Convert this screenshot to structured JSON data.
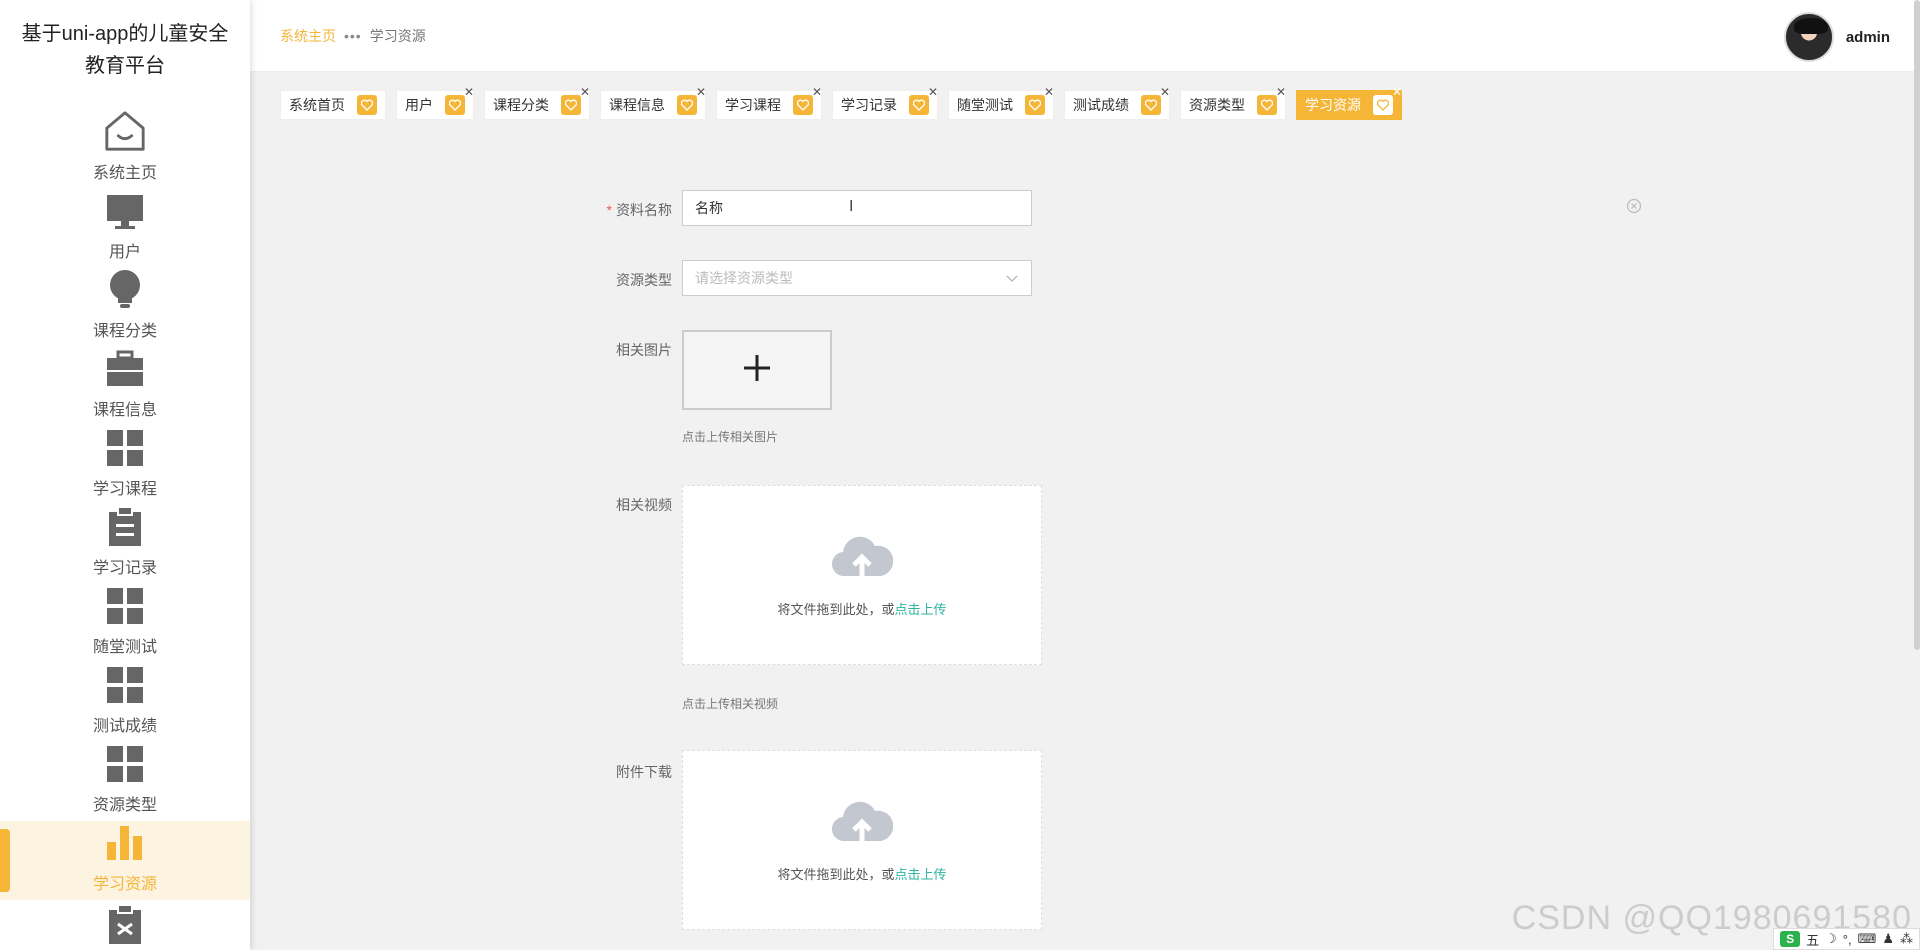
{
  "brand": {
    "title_line1": "基于uni-app的儿童安全",
    "title_line2": "教育平台"
  },
  "header": {
    "breadcrumb_home": "系统主页",
    "breadcrumb_sep": "•••",
    "breadcrumb_current": "学习资源",
    "username": "admin"
  },
  "sidebar": {
    "items": [
      {
        "label": "系统主页",
        "icon": "home-icon"
      },
      {
        "label": "用户",
        "icon": "monitor-icon"
      },
      {
        "label": "课程分类",
        "icon": "lightbulb-icon"
      },
      {
        "label": "课程信息",
        "icon": "briefcase-icon"
      },
      {
        "label": "学习课程",
        "icon": "grid-icon"
      },
      {
        "label": "学习记录",
        "icon": "clipboard-icon"
      },
      {
        "label": "随堂测试",
        "icon": "grid-icon"
      },
      {
        "label": "测试成绩",
        "icon": "grid-icon"
      },
      {
        "label": "资源类型",
        "icon": "grid-icon"
      },
      {
        "label": "学习资源",
        "icon": "bar-chart-icon"
      }
    ],
    "active": "学习资源"
  },
  "tabs": [
    {
      "label": "系统首页",
      "closable": false,
      "active": false
    },
    {
      "label": "用户",
      "closable": true,
      "active": false
    },
    {
      "label": "课程分类",
      "closable": true,
      "active": false
    },
    {
      "label": "课程信息",
      "closable": true,
      "active": false
    },
    {
      "label": "学习课程",
      "closable": true,
      "active": false
    },
    {
      "label": "学习记录",
      "closable": true,
      "active": false
    },
    {
      "label": "随堂测试",
      "closable": true,
      "active": false
    },
    {
      "label": "测试成绩",
      "closable": true,
      "active": false
    },
    {
      "label": "资源类型",
      "closable": true,
      "active": false
    },
    {
      "label": "学习资源",
      "closable": true,
      "active": true
    }
  ],
  "form": {
    "name_label": "资料名称",
    "name_value": "名称",
    "type_label": "资源类型",
    "type_placeholder": "请选择资源类型",
    "image_label": "相关图片",
    "image_hint": "点击上传相关图片",
    "video_label": "相关视频",
    "video_drop_text": "将文件拖到此处，或",
    "video_drop_link": "点击上传",
    "video_hint": "点击上传相关视频",
    "attach_label": "附件下载",
    "attach_drop_text": "将文件拖到此处，或",
    "attach_drop_link": "点击上传"
  },
  "colors": {
    "accent": "#f5b638",
    "link": "#2bb3a0",
    "background": "#f1f1f1"
  },
  "watermark": "CSDN @QQ1980691580",
  "ime": {
    "logo": "S",
    "mode": "五"
  }
}
